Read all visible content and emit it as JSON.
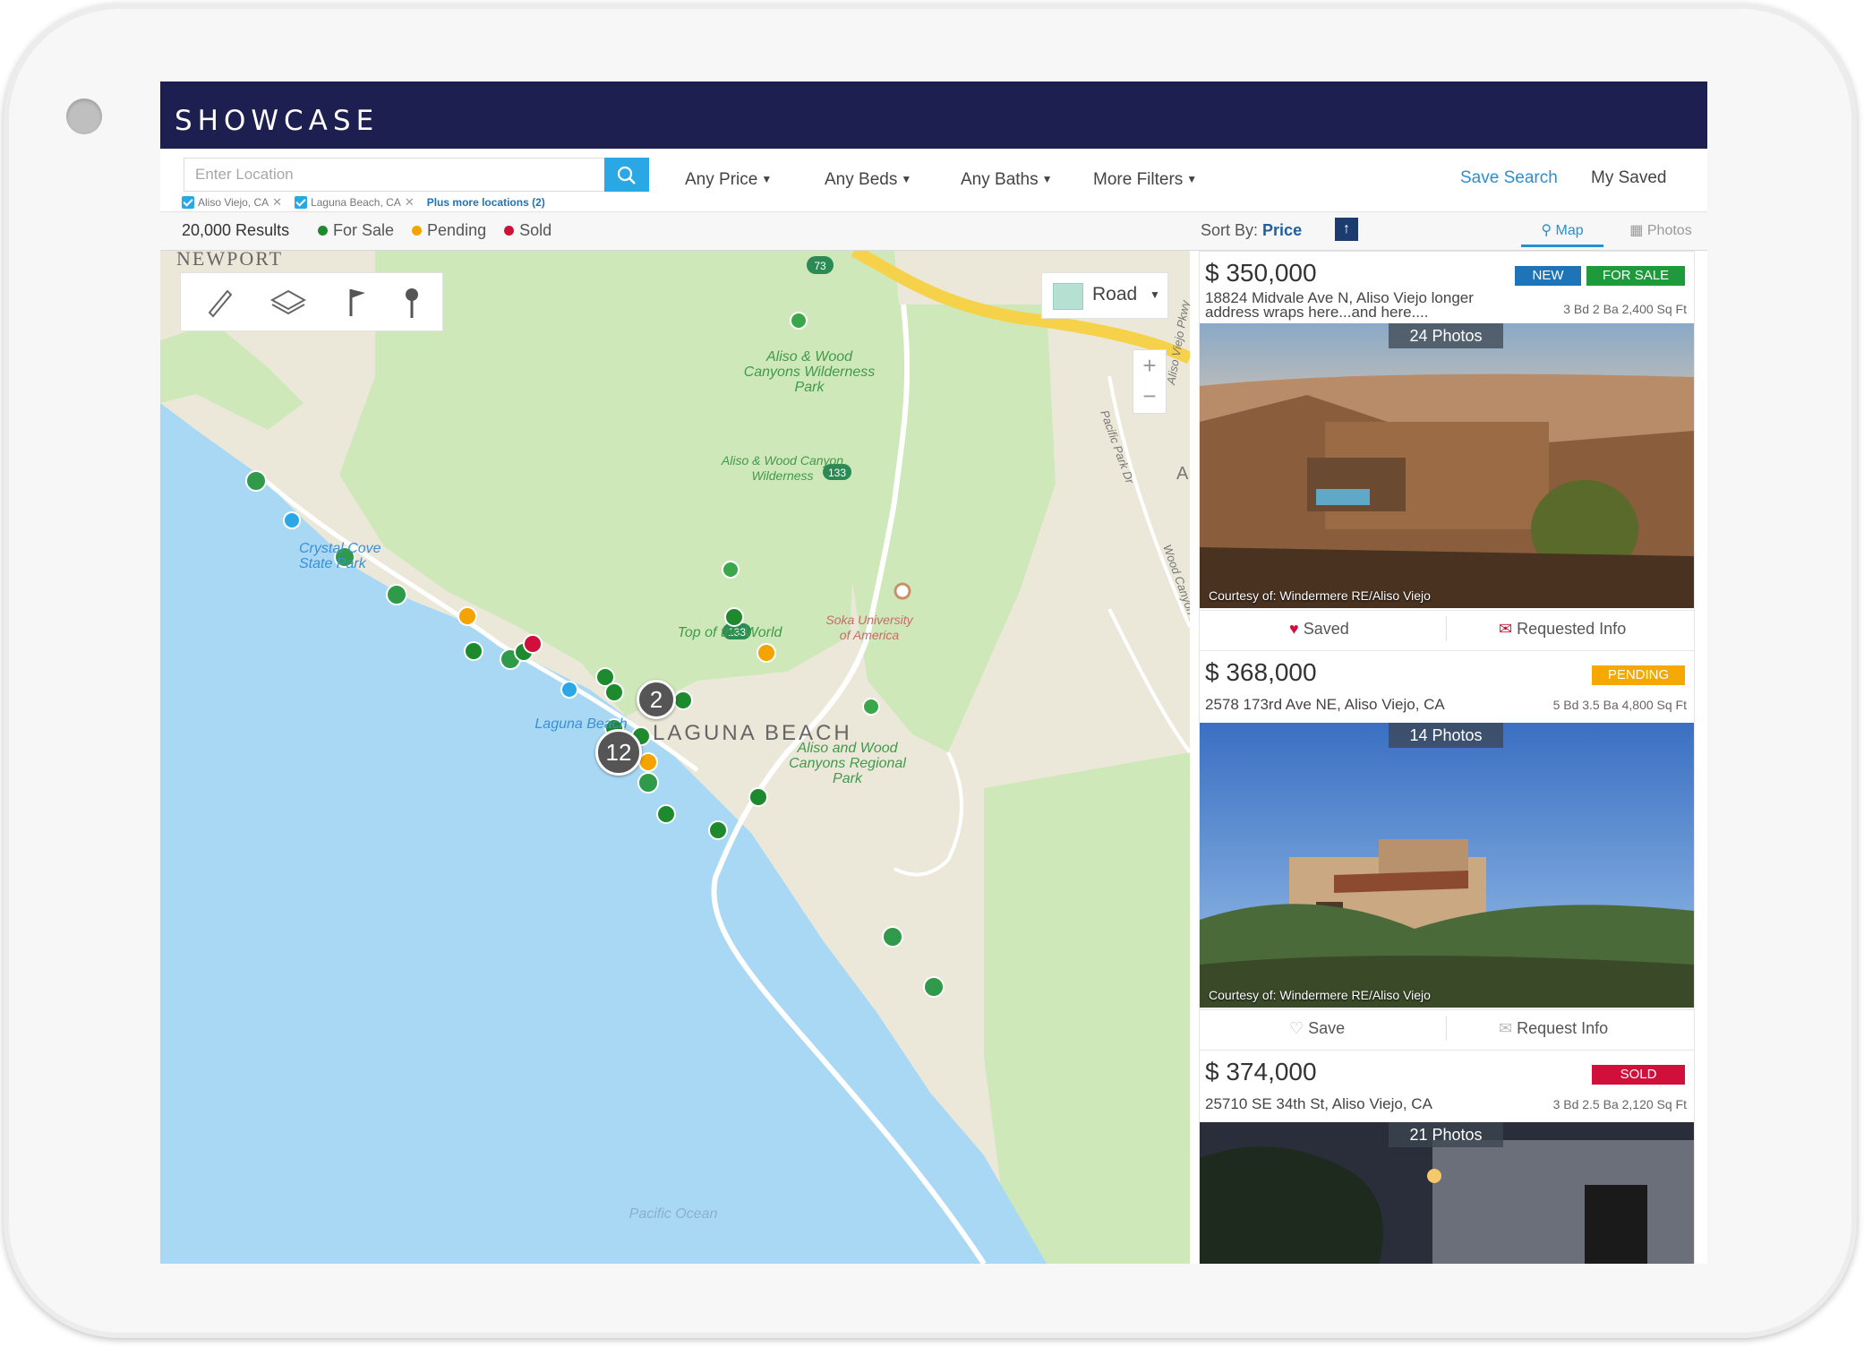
{
  "app": {
    "logo_text": "SHOWCASE"
  },
  "search": {
    "placeholder": "Enter Location",
    "chips": [
      "Aliso Viejo, CA",
      "Laguna Beach, CA"
    ],
    "more_locations": "Plus more locations (2)"
  },
  "filters": {
    "price": "Any Price",
    "beds": "Any Beds",
    "baths": "Any Baths",
    "more": "More Filters",
    "save_search": "Save Search",
    "my_saved": "My Saved"
  },
  "results": {
    "count": "20,000 Results",
    "legend": [
      {
        "label": "For Sale",
        "color": "#1e8a2e"
      },
      {
        "label": "Pending",
        "color": "#f4a300"
      },
      {
        "label": "Sold",
        "color": "#d0103a"
      }
    ],
    "sort_label": "Sort By:",
    "sort_value": "Price",
    "tab_map": "Map",
    "tab_photos": "Photos"
  },
  "map": {
    "layer_label": "Road",
    "city": "LAGUNA BEACH",
    "newport": "NEWPORT",
    "ali": "ALI",
    "labels": {
      "aliso_wood_park": "Aliso & Wood Canyons Wilderness Park",
      "aliso_wood_wild": "Aliso & Wood Canyon Wilderness",
      "crystal_cove": "Crystal Cove State Park",
      "laguna_beach_pt": "Laguna Beach",
      "top_world": "Top of the World",
      "soka": "Soka University of America",
      "aliso_regional": "Aliso and Wood Canyons Regional Park",
      "pacific_ocean": "Pacific Ocean",
      "pacific_park": "Pacific Park Dr",
      "aliso_viejo_pkwy": "Aliso Viejo Pkwy",
      "wood_canyon": "Wood Canyon Dr"
    },
    "route_shields": [
      "73",
      "133",
      "133"
    ],
    "clusters": [
      "2",
      "12"
    ]
  },
  "listings": [
    {
      "price": "$ 350,000",
      "address": "18824 Midvale Ave N, Aliso Viejo longer address wraps here...and here....",
      "specs": "3 Bd  2 Ba  2,400 Sq Ft",
      "badges": [
        {
          "text": "NEW",
          "color": "#1f73b7"
        },
        {
          "text": "FOR SALE",
          "color": "#1e9a3a"
        }
      ],
      "photos": "24 Photos",
      "courtesy": "Courtesy of: Windermere RE/Aliso Viejo",
      "action1": "Saved",
      "action2": "Requested Info"
    },
    {
      "price": "$ 368,000",
      "address": "2578 173rd Ave NE, Aliso Viejo, CA",
      "specs": "5 Bd  3.5 Ba  4,800 Sq Ft",
      "badges": [
        {
          "text": "PENDING",
          "color": "#f5a800"
        }
      ],
      "photos": "14 Photos",
      "courtesy": "Courtesy of: Windermere RE/Aliso Viejo",
      "action1": "Save",
      "action2": "Request Info"
    },
    {
      "price": "$ 374,000",
      "address": "25710 SE 34th St, Aliso Viejo, CA",
      "specs": "3 Bd  2.5 Ba  2,120 Sq Ft",
      "badges": [
        {
          "text": "SOLD",
          "color": "#d0103a"
        }
      ],
      "photos": "21 Photos"
    }
  ]
}
